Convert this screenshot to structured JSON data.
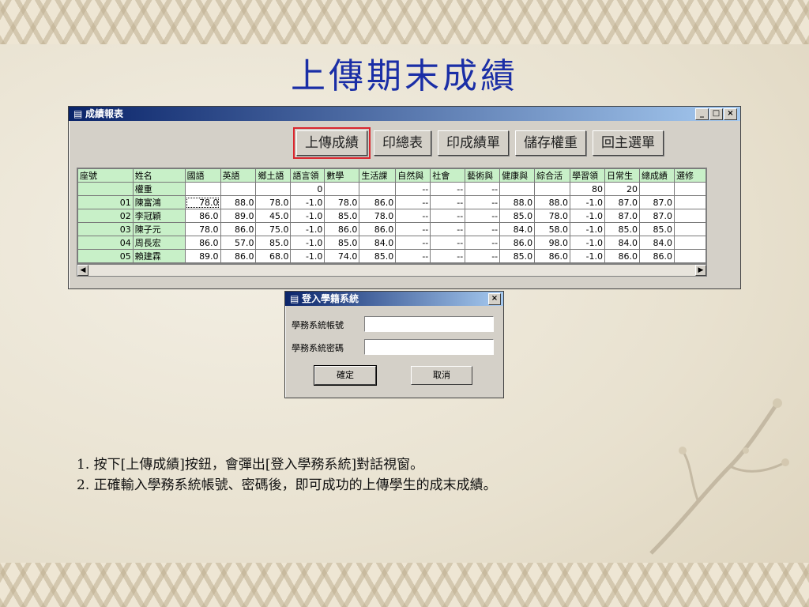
{
  "slide": {
    "title": "上傳期末成績",
    "notes": [
      "1. 按下[上傳成績]按鈕，會彈出[登入學務系統]對話視窗。",
      "2. 正確輸入學務系統帳號、密碼後，即可成功的上傳學生的成末成績。"
    ]
  },
  "window": {
    "title": "成績報表",
    "controls": {
      "minimize": "_",
      "maximize": "□",
      "close": "×"
    },
    "toolbar": [
      {
        "label": "上傳成績",
        "highlighted": true
      },
      {
        "label": "印總表"
      },
      {
        "label": "印成績單"
      },
      {
        "label": "儲存權重"
      },
      {
        "label": "回主選單"
      }
    ],
    "grid": {
      "headers": [
        "座號",
        "姓名",
        "國語",
        "英語",
        "鄉土語",
        "語言領",
        "數學",
        "生活課",
        "自然與",
        "社會",
        "藝術與",
        "健康與",
        "綜合活",
        "學習領",
        "日常生",
        "總成績",
        "選修"
      ],
      "weight_row": [
        "",
        "權重",
        "",
        "",
        "",
        "0",
        "",
        "",
        "--",
        "--",
        "--",
        "",
        "",
        "80",
        "20",
        "",
        ""
      ],
      "rows": [
        [
          "01",
          "陳富鴻",
          "78.0",
          "88.0",
          "78.0",
          "-1.0",
          "78.0",
          "86.0",
          "--",
          "--",
          "--",
          "88.0",
          "88.0",
          "-1.0",
          "87.0",
          "87.0",
          ""
        ],
        [
          "02",
          "李冠穎",
          "86.0",
          "89.0",
          "45.0",
          "-1.0",
          "85.0",
          "78.0",
          "--",
          "--",
          "--",
          "85.0",
          "78.0",
          "-1.0",
          "87.0",
          "87.0",
          ""
        ],
        [
          "03",
          "陳子元",
          "78.0",
          "86.0",
          "75.0",
          "-1.0",
          "86.0",
          "86.0",
          "--",
          "--",
          "--",
          "84.0",
          "58.0",
          "-1.0",
          "85.0",
          "85.0",
          ""
        ],
        [
          "04",
          "周長宏",
          "86.0",
          "57.0",
          "85.0",
          "-1.0",
          "85.0",
          "84.0",
          "--",
          "--",
          "--",
          "86.0",
          "98.0",
          "-1.0",
          "84.0",
          "84.0",
          ""
        ],
        [
          "05",
          "賴建霖",
          "89.0",
          "86.0",
          "68.0",
          "-1.0",
          "74.0",
          "85.0",
          "--",
          "--",
          "--",
          "85.0",
          "86.0",
          "-1.0",
          "86.0",
          "86.0",
          ""
        ]
      ]
    }
  },
  "dialog": {
    "title": "登入學籍系統",
    "close": "×",
    "account_label": "學務系統帳號",
    "password_label": "學務系統密碼",
    "account_value": "",
    "password_value": "",
    "ok_label": "確定",
    "cancel_label": "取消"
  },
  "colors": {
    "title": "#1a2ea6",
    "grid_header": "#c8f0c8",
    "highlight": "#d9262e"
  }
}
